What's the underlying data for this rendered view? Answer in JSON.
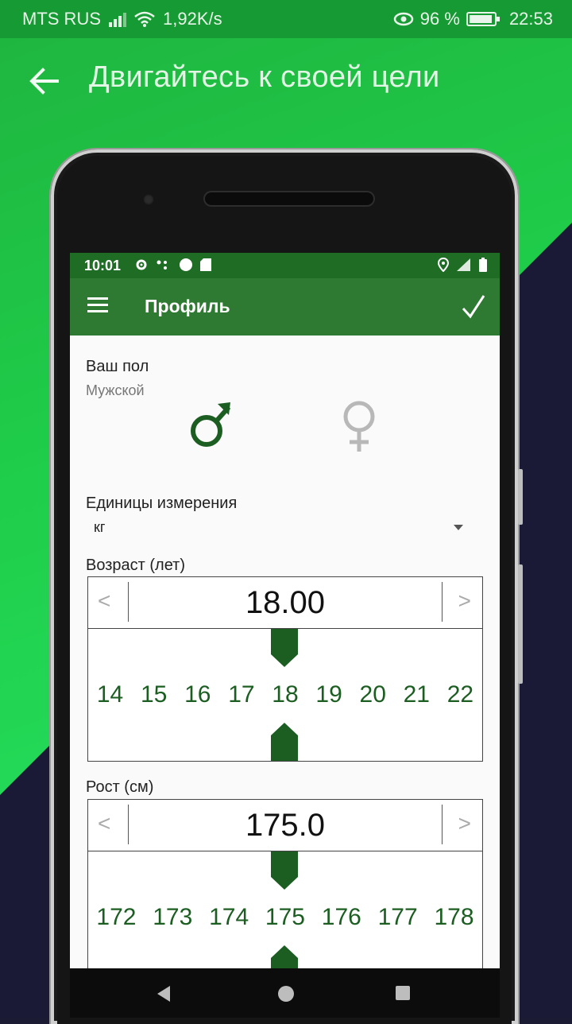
{
  "system_status": {
    "carrier": "MTS RUS",
    "speed": "1,92K/s",
    "battery_percent": "96 %",
    "time": "22:53"
  },
  "header": {
    "title": "Двигайтесь к своей цели"
  },
  "app_status": {
    "time": "10:01"
  },
  "toolbar": {
    "title": "Профиль"
  },
  "profile": {
    "gender_label": "Ваш пол",
    "gender_value": "Мужской",
    "units_label": "Единицы измерения",
    "units_value": "кг"
  },
  "age_picker": {
    "label": "Возраст (лет)",
    "value": "18.00",
    "prev": "<",
    "next": ">",
    "ticks": [
      "14",
      "15",
      "16",
      "17",
      "18",
      "19",
      "20",
      "21",
      "22"
    ]
  },
  "height_picker": {
    "label": "Рост (см)",
    "value": "175.0",
    "prev": "<",
    "next": ">",
    "ticks": [
      "172",
      "173",
      "174",
      "175",
      "176",
      "177",
      "178"
    ]
  },
  "colors": {
    "toolbar": "#2f7a32",
    "accent_green": "#1c5e22",
    "female_inactive": "#b8b8b8"
  }
}
